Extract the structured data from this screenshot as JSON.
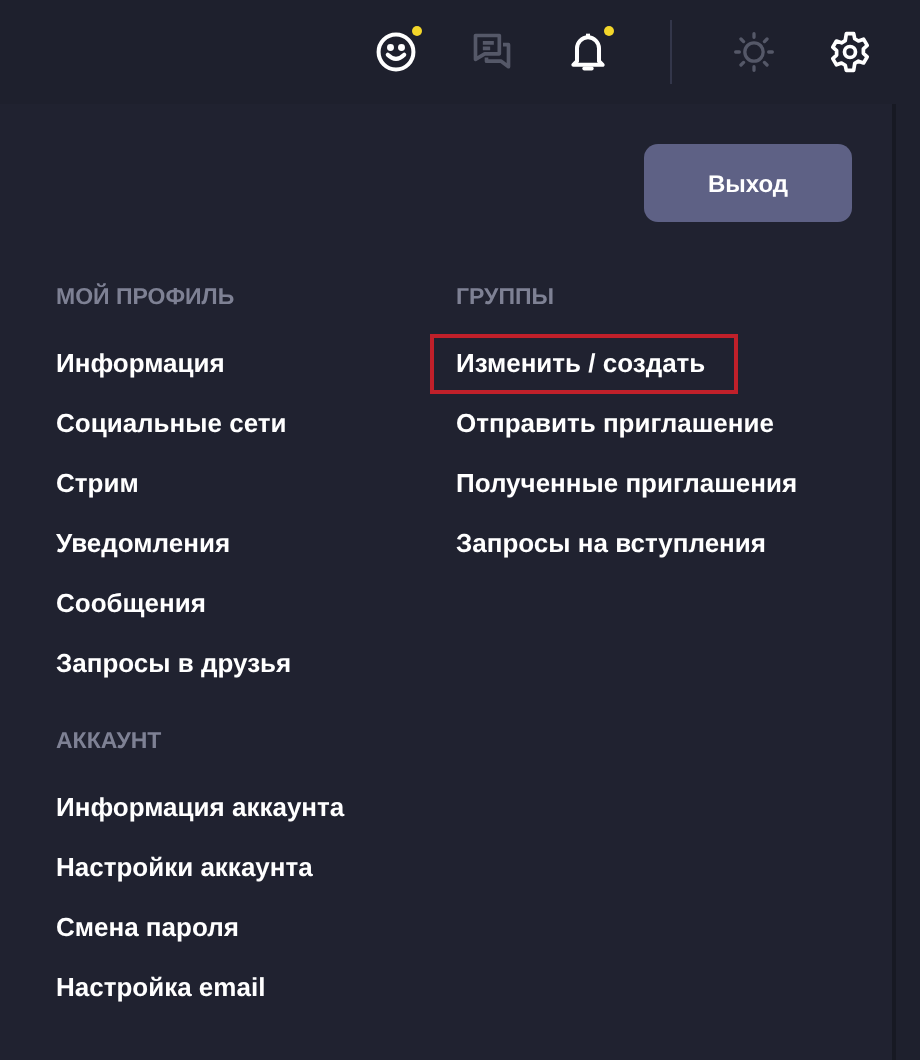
{
  "header_icons": [
    {
      "kind": "smiley",
      "badge": true,
      "disabled": false
    },
    {
      "kind": "chat",
      "badge": false,
      "disabled": true
    },
    {
      "kind": "bell",
      "badge": true,
      "disabled": false
    },
    {
      "kind": "divider"
    },
    {
      "kind": "sun",
      "badge": false,
      "disabled": true
    },
    {
      "kind": "gear",
      "badge": false,
      "disabled": false
    }
  ],
  "logout_button": "Выход",
  "columns": [
    {
      "sections": [
        {
          "title": "МОЙ ПРОФИЛЬ",
          "items": [
            {
              "label": "Информация",
              "highlighted": false
            },
            {
              "label": "Социальные сети",
              "highlighted": false
            },
            {
              "label": "Стрим",
              "highlighted": false
            },
            {
              "label": "Уведомления",
              "highlighted": false
            },
            {
              "label": "Сообщения",
              "highlighted": false
            },
            {
              "label": "Запросы в друзья",
              "highlighted": false
            }
          ]
        },
        {
          "title": "АККАУНТ",
          "items": [
            {
              "label": "Информация аккаунта",
              "highlighted": false
            },
            {
              "label": "Настройки аккаунта",
              "highlighted": false
            },
            {
              "label": "Смена пароля",
              "highlighted": false
            },
            {
              "label": "Настройка email",
              "highlighted": false
            }
          ]
        }
      ]
    },
    {
      "sections": [
        {
          "title": "ГРУППЫ",
          "items": [
            {
              "label": "Изменить / создать",
              "highlighted": true
            },
            {
              "label": "Отправить приглашение",
              "highlighted": false
            },
            {
              "label": "Полученные приглашения",
              "highlighted": false
            },
            {
              "label": "Запросы на вступления",
              "highlighted": false
            }
          ]
        }
      ]
    }
  ]
}
